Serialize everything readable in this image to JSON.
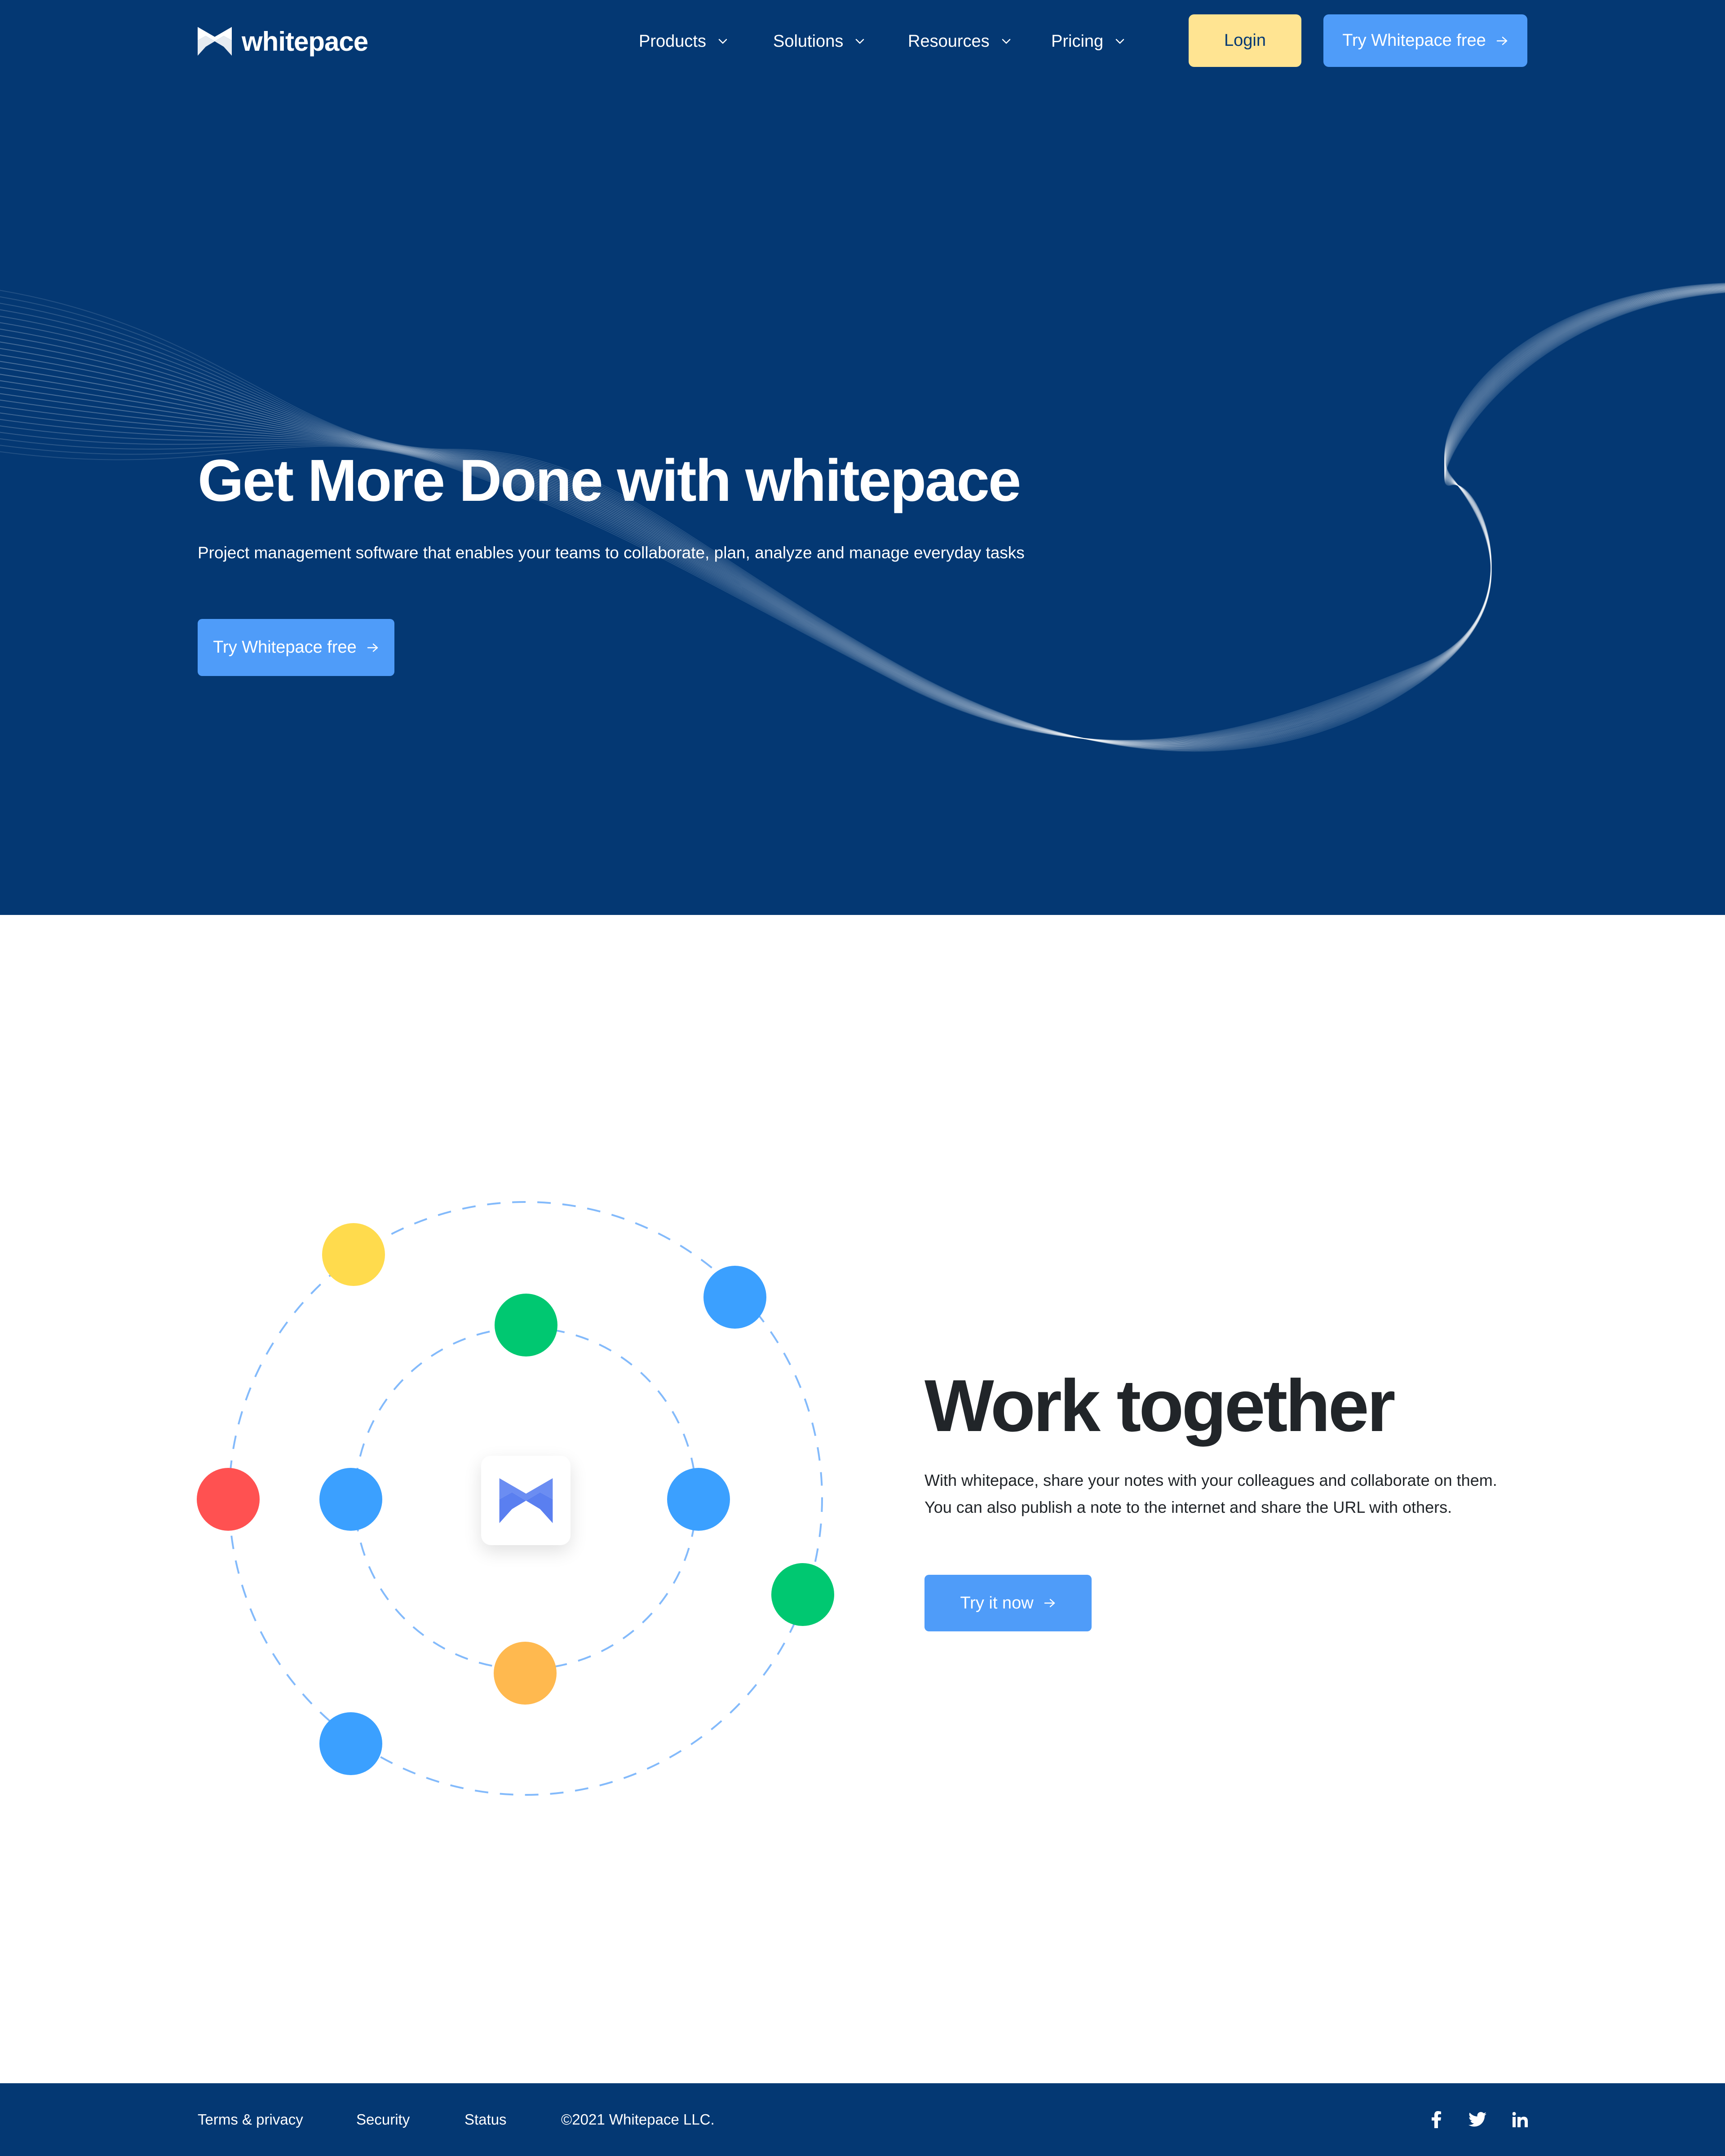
{
  "colors": {
    "brand_dark": "#043873",
    "accent_blue": "#4f9cf9",
    "accent_yellow": "#ffe492",
    "text_dark": "#212529",
    "node_yellow": "#ffdb4d",
    "node_blue": "#3ba0ff",
    "node_green": "#00c871",
    "node_red": "#ff5151",
    "node_orange": "#ffb94f"
  },
  "brand": {
    "name": "whitepace",
    "logo_icon": "whitepace-logo-icon"
  },
  "nav": {
    "items": [
      {
        "label": "Products",
        "icon": "chevron-down-icon"
      },
      {
        "label": "Solutions",
        "icon": "chevron-down-icon"
      },
      {
        "label": "Resources",
        "icon": "chevron-down-icon"
      },
      {
        "label": "Pricing",
        "icon": "chevron-down-icon"
      }
    ],
    "login_label": "Login",
    "try_label": "Try Whitepace free"
  },
  "hero": {
    "title": "Get More Done with whitepace",
    "subtitle": "Project management software that enables your teams to collaborate, plan, analyze and manage everyday tasks",
    "cta_label": "Try Whitepace free"
  },
  "work_together": {
    "title_start": "Work ",
    "title_highlight": "together",
    "description_line1": "With whitepace, share your notes with your colleagues and collaborate on them.",
    "description_line2": "You can also publish a note to the internet and share the URL with others.",
    "cta_label": "Try it now"
  },
  "footer": {
    "links": [
      "Terms & privacy",
      "Security",
      "Status"
    ],
    "copyright": "©2021 Whitepace LLC.",
    "social": [
      "facebook-icon",
      "twitter-icon",
      "linkedin-icon"
    ]
  }
}
